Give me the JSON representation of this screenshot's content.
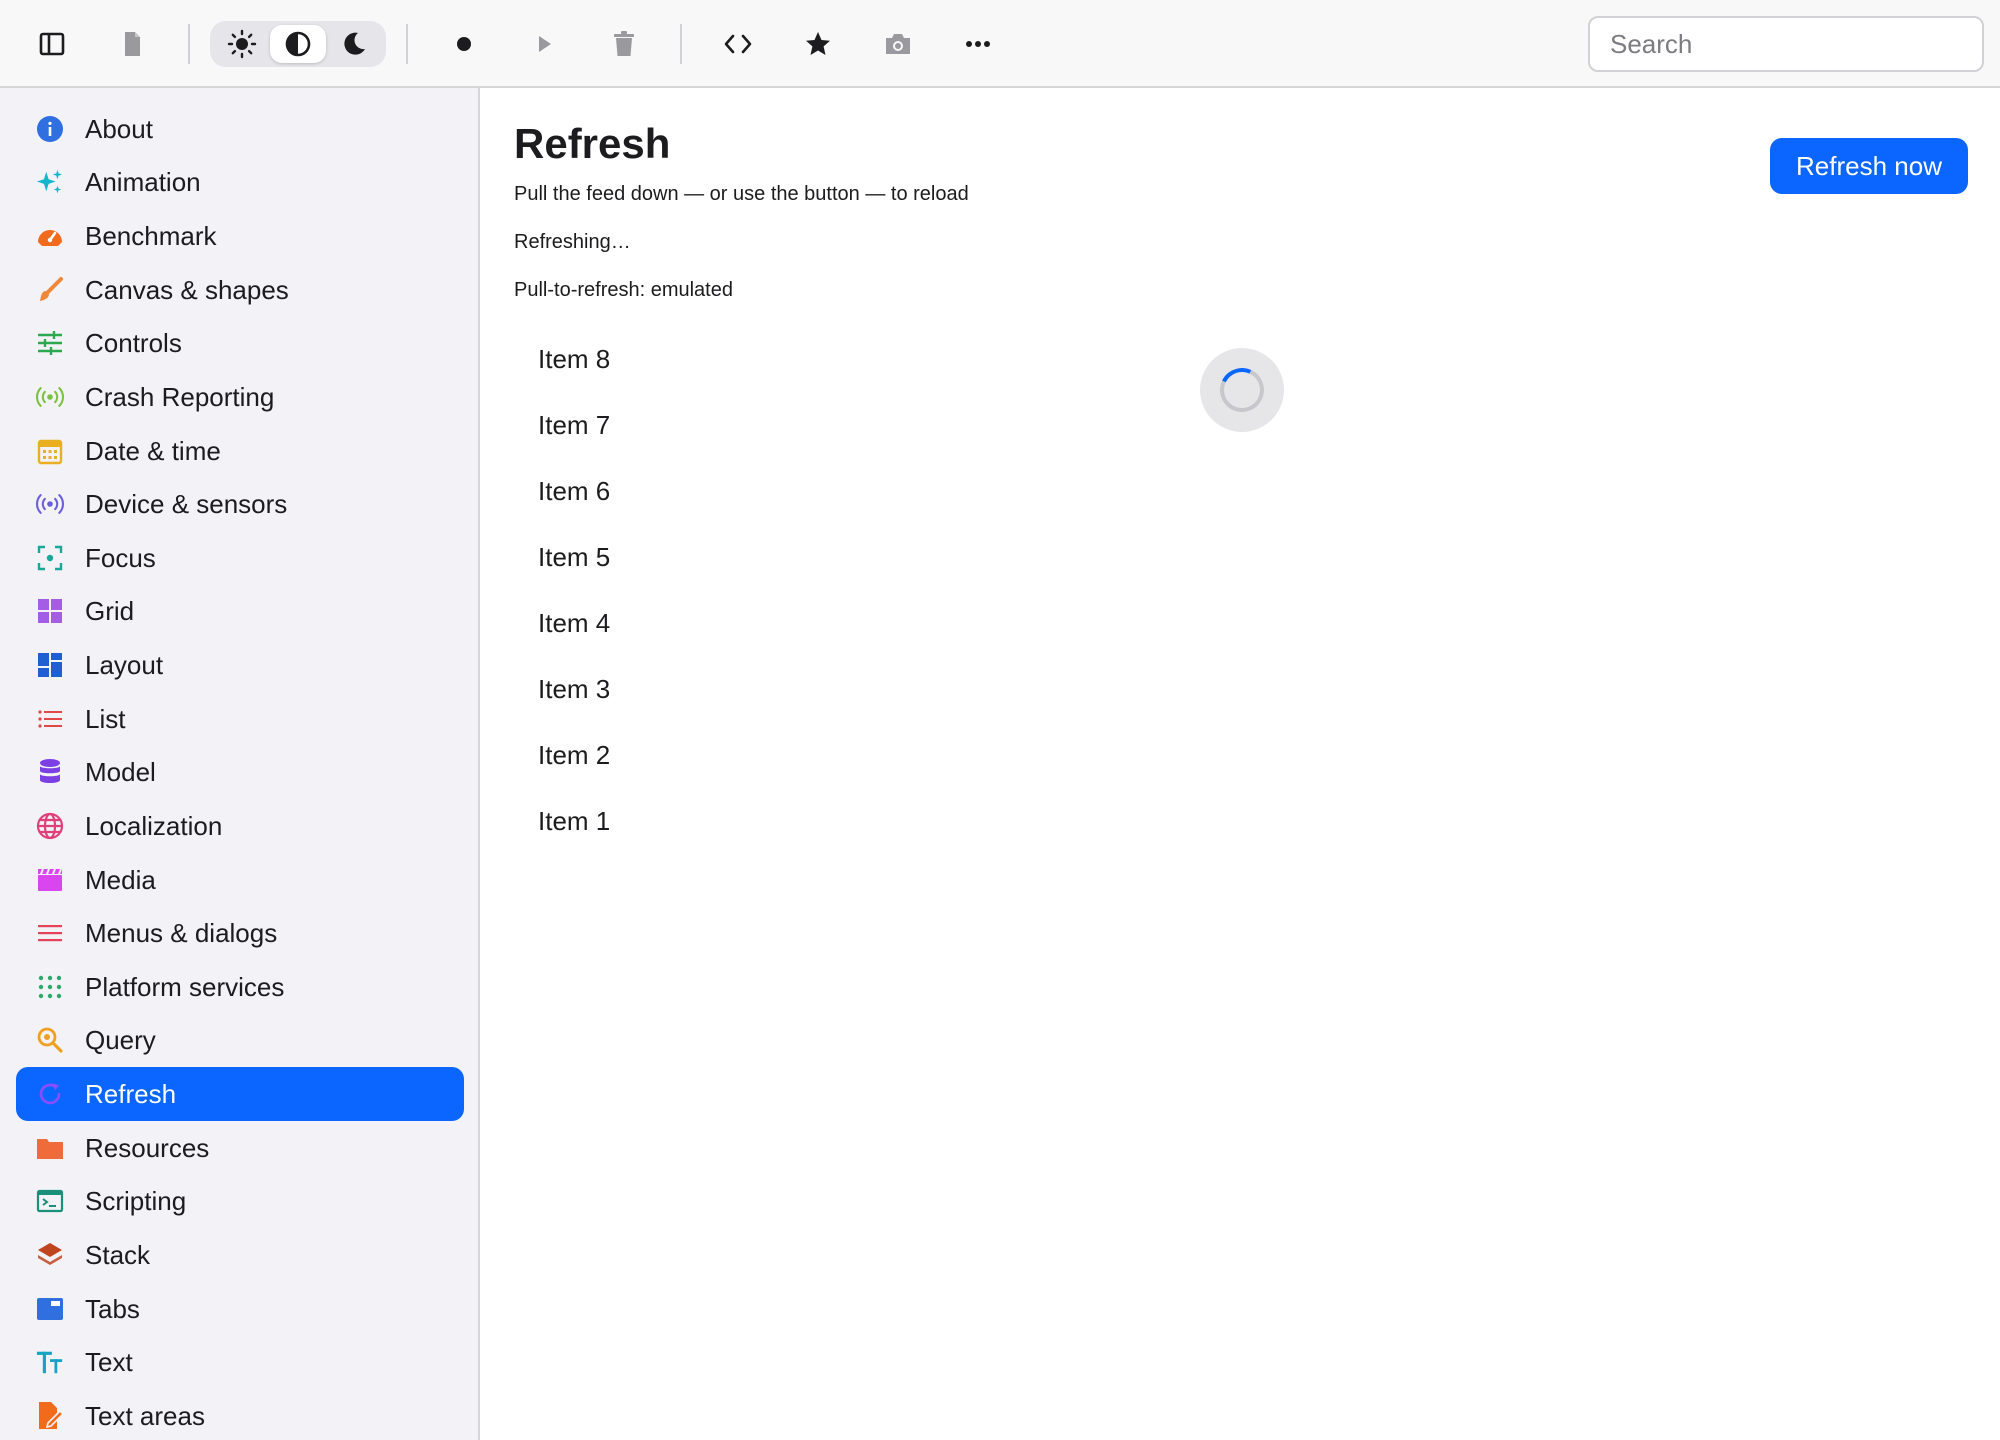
{
  "toolbar": {
    "search_placeholder": "Search",
    "buttons": [
      {
        "name": "sidebar-toggle-icon"
      },
      {
        "name": "document-icon"
      },
      {
        "name": "record-icon"
      },
      {
        "name": "play-icon"
      },
      {
        "name": "trash-icon"
      },
      {
        "name": "code-icon"
      },
      {
        "name": "star-icon"
      },
      {
        "name": "camera-icon"
      },
      {
        "name": "more-icon"
      }
    ],
    "theme_options": [
      "light",
      "auto",
      "dark"
    ],
    "theme_selected": "auto"
  },
  "sidebar": {
    "items": [
      {
        "label": "About",
        "icon": "info-icon",
        "color": "#2f6fe0"
      },
      {
        "label": "Animation",
        "icon": "sparkles-icon",
        "color": "#13b7c9"
      },
      {
        "label": "Benchmark",
        "icon": "speedometer-icon",
        "color": "#f26b1d"
      },
      {
        "label": "Canvas & shapes",
        "icon": "paintbrush-icon",
        "color": "#f0883a"
      },
      {
        "label": "Controls",
        "icon": "sliders-icon",
        "color": "#2ea84f"
      },
      {
        "label": "Crash Reporting",
        "icon": "broadcast-icon",
        "color": "#7ac142"
      },
      {
        "label": "Date & time",
        "icon": "calendar-icon",
        "color": "#e8b021"
      },
      {
        "label": "Device & sensors",
        "icon": "sensor-icon",
        "color": "#6a5fd6"
      },
      {
        "label": "Focus",
        "icon": "focus-icon",
        "color": "#1aa79a"
      },
      {
        "label": "Grid",
        "icon": "grid-icon",
        "color": "#a45ee5"
      },
      {
        "label": "Layout",
        "icon": "layout-icon",
        "color": "#1f5fd1"
      },
      {
        "label": "List",
        "icon": "list-icon",
        "color": "#e04848"
      },
      {
        "label": "Model",
        "icon": "database-icon",
        "color": "#7b3fe4"
      },
      {
        "label": "Localization",
        "icon": "globe-icon",
        "color": "#e0407a"
      },
      {
        "label": "Media",
        "icon": "clapperboard-icon",
        "color": "#d946ef"
      },
      {
        "label": "Menus & dialogs",
        "icon": "menu-icon",
        "color": "#e5435a"
      },
      {
        "label": "Platform services",
        "icon": "dots-grid-icon",
        "color": "#2ea86a"
      },
      {
        "label": "Query",
        "icon": "magnifier-icon",
        "color": "#f0a020"
      },
      {
        "label": "Refresh",
        "icon": "refresh-icon",
        "color": "#8a4dff"
      },
      {
        "label": "Resources",
        "icon": "folder-icon",
        "color": "#ef6b3a"
      },
      {
        "label": "Scripting",
        "icon": "terminal-icon",
        "color": "#1a8f7a"
      },
      {
        "label": "Stack",
        "icon": "layers-icon",
        "color": "#c0441e"
      },
      {
        "label": "Tabs",
        "icon": "tabs-icon",
        "color": "#2f6fe0"
      },
      {
        "label": "Text",
        "icon": "text-size-icon",
        "color": "#16a3c7"
      },
      {
        "label": "Text areas",
        "icon": "document-edit-icon",
        "color": "#f26b1d"
      }
    ],
    "active_index": 18
  },
  "main": {
    "title": "Refresh",
    "subtitle": "Pull the feed down — or use the button — to reload",
    "status": "Refreshing…",
    "pull_mode": "Pull-to-refresh: emulated",
    "refresh_button": "Refresh now",
    "items": [
      "Item 8",
      "Item 7",
      "Item 6",
      "Item 5",
      "Item 4",
      "Item 3",
      "Item 2",
      "Item 1"
    ]
  },
  "colors": {
    "accent": "#0a66ff",
    "sidebar_bg": "#f2f2f7",
    "toolbar_bg": "#f8f8f8"
  }
}
